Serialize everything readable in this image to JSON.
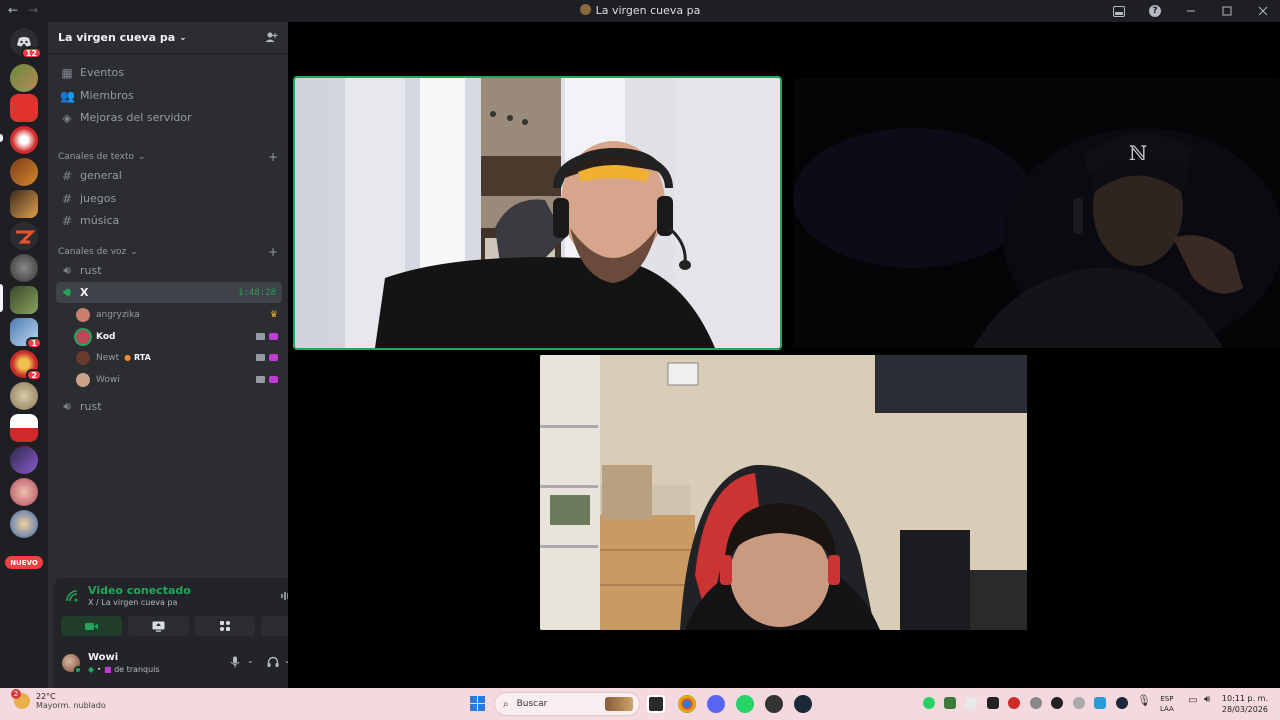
{
  "window": {
    "title": "La virgen cueva pa",
    "back": "←",
    "forward": "→",
    "help_icon": "?"
  },
  "rail": {
    "dm_badge": "12",
    "badges": [
      "1",
      "2"
    ],
    "new_label": "NUEVO"
  },
  "server": {
    "name": "La virgen cueva pa",
    "top_items": [
      {
        "label": "Eventos",
        "icon": "calendar-icon"
      },
      {
        "label": "Miembros",
        "icon": "members-icon"
      },
      {
        "label": "Mejoras del servidor",
        "icon": "boost-icon"
      }
    ],
    "text_category": "Canales de texto",
    "text_channels": [
      "general",
      "juegos",
      "música"
    ],
    "voice_category": "Canales de voz",
    "voice_channels": [
      {
        "name": "rust"
      },
      {
        "name": "X",
        "timer": "1:48:28"
      },
      {
        "name": "rust"
      }
    ],
    "voice_members": [
      {
        "name": "angryzika",
        "avatar": "#c77f6a"
      },
      {
        "name": "Kod",
        "avatar": "#b84a55"
      },
      {
        "name": "Newt",
        "tag": "RTA",
        "avatar": "#6a3a2a"
      },
      {
        "name": "Wowi",
        "avatar": "#caa28a"
      }
    ]
  },
  "voice_panel": {
    "status": "Video conectado",
    "location": "X / La virgen cueva pa"
  },
  "user_panel": {
    "name": "Wowi",
    "status": "de tranquis"
  },
  "taskbar": {
    "temperature": "22°C",
    "weather": "Mayorm. nublado",
    "weather_badge": "2",
    "search_placeholder": "Buscar",
    "lang_line1": "ESP",
    "lang_line2": "LAA",
    "time": "10:11 p. m.",
    "date": "28/03/2026"
  }
}
